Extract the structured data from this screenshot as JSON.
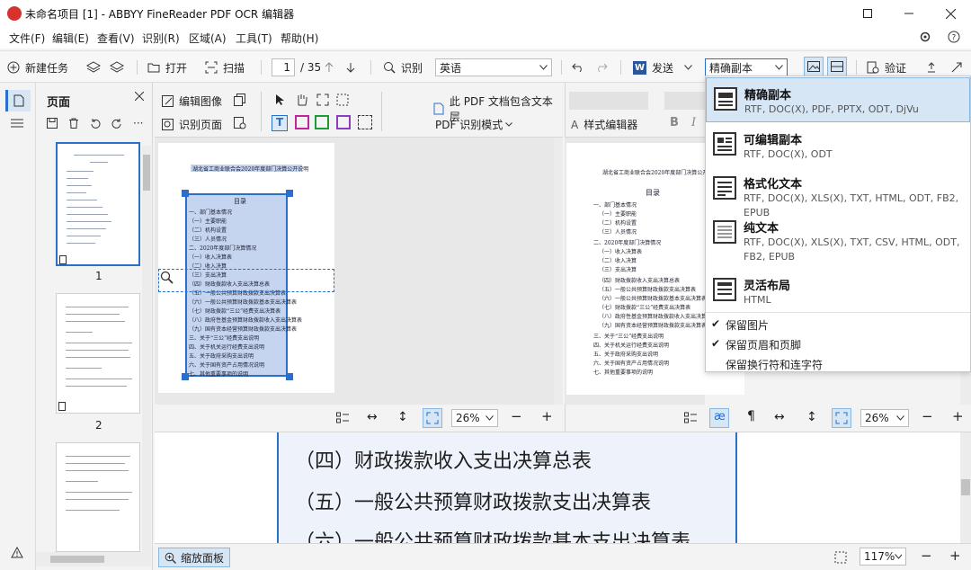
{
  "window": {
    "title": "未命名项目 [1] - ABBYY FineReader PDF OCR 编辑器"
  },
  "menu": [
    "文件(F)",
    "编辑(E)",
    "查看(V)",
    "识别(R)",
    "区域(A)",
    "工具(T)",
    "帮助(H)"
  ],
  "toolbar": {
    "new_task": "新建任务",
    "open": "打开",
    "scan": "扫描",
    "page_current": "1",
    "page_total": "/ 35",
    "recognize": "识别",
    "language": "英语",
    "send": "发送",
    "format": "精确副本",
    "verify": "验证"
  },
  "pages_panel": {
    "title": "页面",
    "thumb_labels": [
      "1",
      "2"
    ]
  },
  "image_pane": {
    "edit_image": "编辑图像",
    "recognize_page": "识别页面",
    "pdf_note": "此 PDF 文档包含文本层",
    "pdf_mode": "PDF 识别模式",
    "zoom": "26%"
  },
  "text_pane": {
    "style_editor": "样式编辑器",
    "bold": "B",
    "italic": "I",
    "zoom": "26%"
  },
  "page_doc": {
    "heading": "湖北省工商业联合会2020年度部门决算公开说明",
    "toc": "目录",
    "lines": [
      "一、部门基本情况",
      "（一）主要职能",
      "（二）机构设置",
      "（三）人员情况",
      "二、2020年度部门决算情况",
      "（一）收入决算表",
      "（二）收入决算",
      "（三）支出决算",
      "（四）财政拨款收入支出决算总表",
      "（五）一般公共预算财政拨款支出决算表",
      "（六）一般公共预算财政拨款基本支出决算表",
      "（七）财政拨款“三公”经费支出决算表",
      "（八）政府性基金预算财政拨款收入支出决算表",
      "（九）国有资本经营预算财政拨款支出决算表",
      "三、关于“三公”经费支出说明",
      "四、关于机关运行经费支出说明",
      "五、关于政府采购支出说明",
      "六、关于国有资产占用情况说明",
      "七、其他重要事项的说明"
    ]
  },
  "zoom_pane": {
    "lines": [
      "（四）财政拨款收入支出决算总表",
      "（五）一般公共预算财政拨款支出决算表",
      "（六）一般公共预算财政拨款基本支出决算表"
    ]
  },
  "status": {
    "zoom_panel": "缩放面板",
    "zoom": "117%"
  },
  "dropdown": {
    "items": [
      {
        "title": "精确副本",
        "formats": "RTF, DOC(X), PDF, PPTX, ODT, DjVu"
      },
      {
        "title": "可编辑副本",
        "formats": "RTF, DOC(X), ODT"
      },
      {
        "title": "格式化文本",
        "formats": "RTF, DOC(X), XLS(X), TXT, HTML, ODT, FB2, EPUB"
      },
      {
        "title": "纯文本",
        "formats": "RTF, DOC(X), XLS(X), TXT, CSV, HTML, ODT, FB2, EPUB"
      },
      {
        "title": "灵活布局",
        "formats": "HTML"
      }
    ],
    "options": [
      {
        "label": "保留图片",
        "checked": true
      },
      {
        "label": "保留页眉和页脚",
        "checked": true
      },
      {
        "label": "保留换行符和连字符",
        "checked": false
      }
    ]
  },
  "colors": {
    "accent": "#2a6fc9",
    "logo": "#d9322c",
    "selection": "#c5d5f0"
  }
}
